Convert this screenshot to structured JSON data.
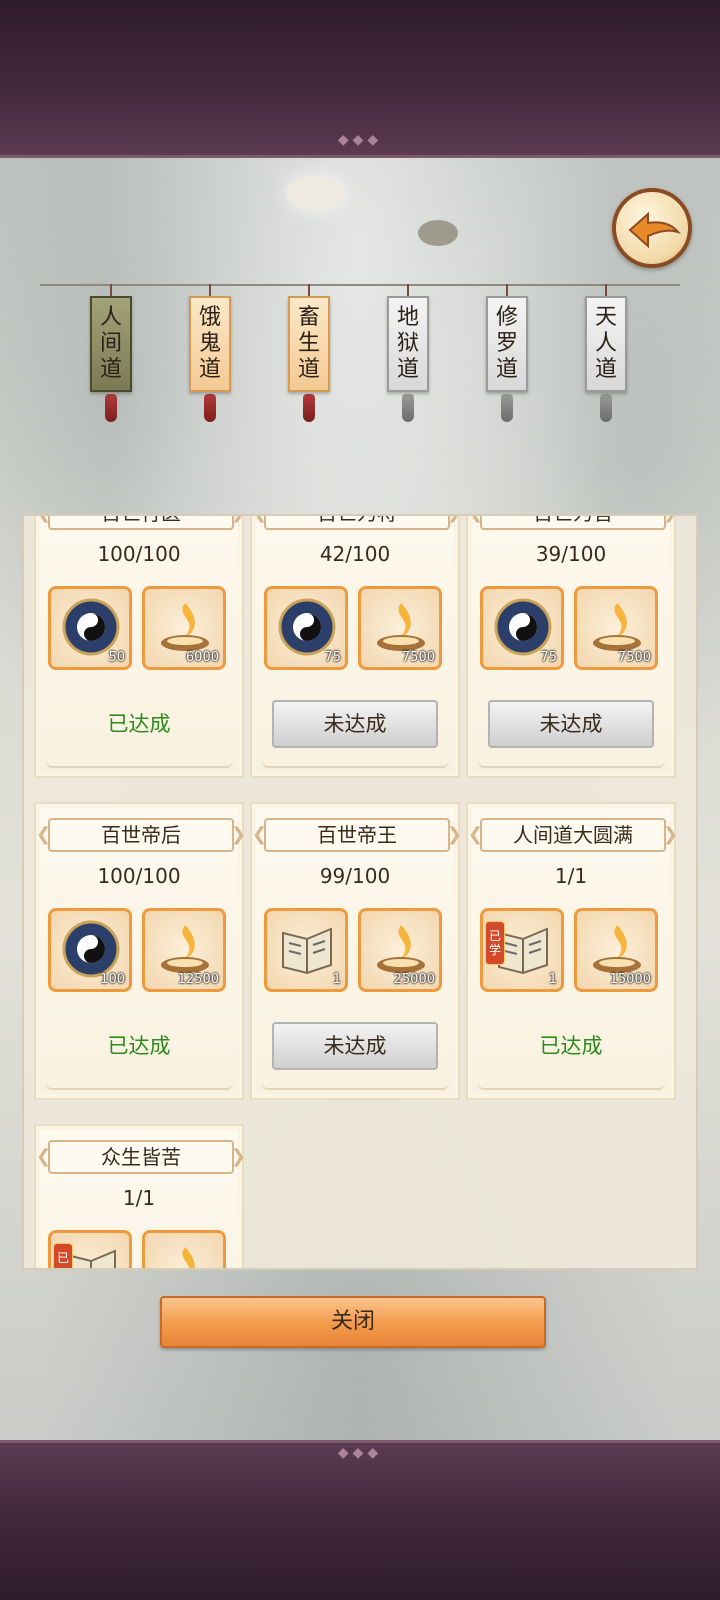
{
  "tabs": [
    {
      "label": "人间道",
      "state": "active"
    },
    {
      "label": "饿鬼道",
      "state": "unlocked"
    },
    {
      "label": "畜生道",
      "state": "unlocked"
    },
    {
      "label": "地狱道",
      "state": "locked"
    },
    {
      "label": "修罗道",
      "state": "locked"
    },
    {
      "label": "天人道",
      "state": "locked"
    }
  ],
  "cards": [
    {
      "title": "百世行医",
      "progress": "100/100",
      "rewards": [
        {
          "icon": "bagua-compass-icon",
          "qty": "50"
        },
        {
          "icon": "flame-bowl-icon",
          "qty": "6000"
        }
      ],
      "status": "已达成"
    },
    {
      "title": "百世为将",
      "progress": "42/100",
      "rewards": [
        {
          "icon": "bagua-compass-icon",
          "qty": "75"
        },
        {
          "icon": "flame-bowl-icon",
          "qty": "7500"
        }
      ],
      "status": "未达成"
    },
    {
      "title": "百世为官",
      "progress": "39/100",
      "rewards": [
        {
          "icon": "bagua-compass-icon",
          "qty": "75"
        },
        {
          "icon": "flame-bowl-icon",
          "qty": "7500"
        }
      ],
      "status": "未达成"
    },
    {
      "title": "百世帝后",
      "progress": "100/100",
      "rewards": [
        {
          "icon": "bagua-compass-icon",
          "qty": "100"
        },
        {
          "icon": "flame-bowl-icon",
          "qty": "12500"
        }
      ],
      "status": "已达成"
    },
    {
      "title": "百世帝王",
      "progress": "99/100",
      "rewards": [
        {
          "icon": "book-icon",
          "qty": "1"
        },
        {
          "icon": "flame-bowl-icon",
          "qty": "25000"
        }
      ],
      "status": "未达成"
    },
    {
      "title": "人间道大圆满",
      "progress": "1/1",
      "rewards": [
        {
          "icon": "book-icon",
          "qty": "1",
          "badge": "已学"
        },
        {
          "icon": "flame-bowl-icon",
          "qty": "15000"
        }
      ],
      "status": "已达成"
    },
    {
      "title": "众生皆苦",
      "progress": "1/1",
      "rewards": [
        {
          "icon": "book-icon",
          "qty": "",
          "badge": "已"
        },
        {
          "icon": "flame-bowl-icon",
          "qty": ""
        }
      ],
      "status": ""
    }
  ],
  "close_label": "关闭",
  "colors": {
    "done": "#2f8a1d",
    "accent": "#ee9a3c"
  }
}
